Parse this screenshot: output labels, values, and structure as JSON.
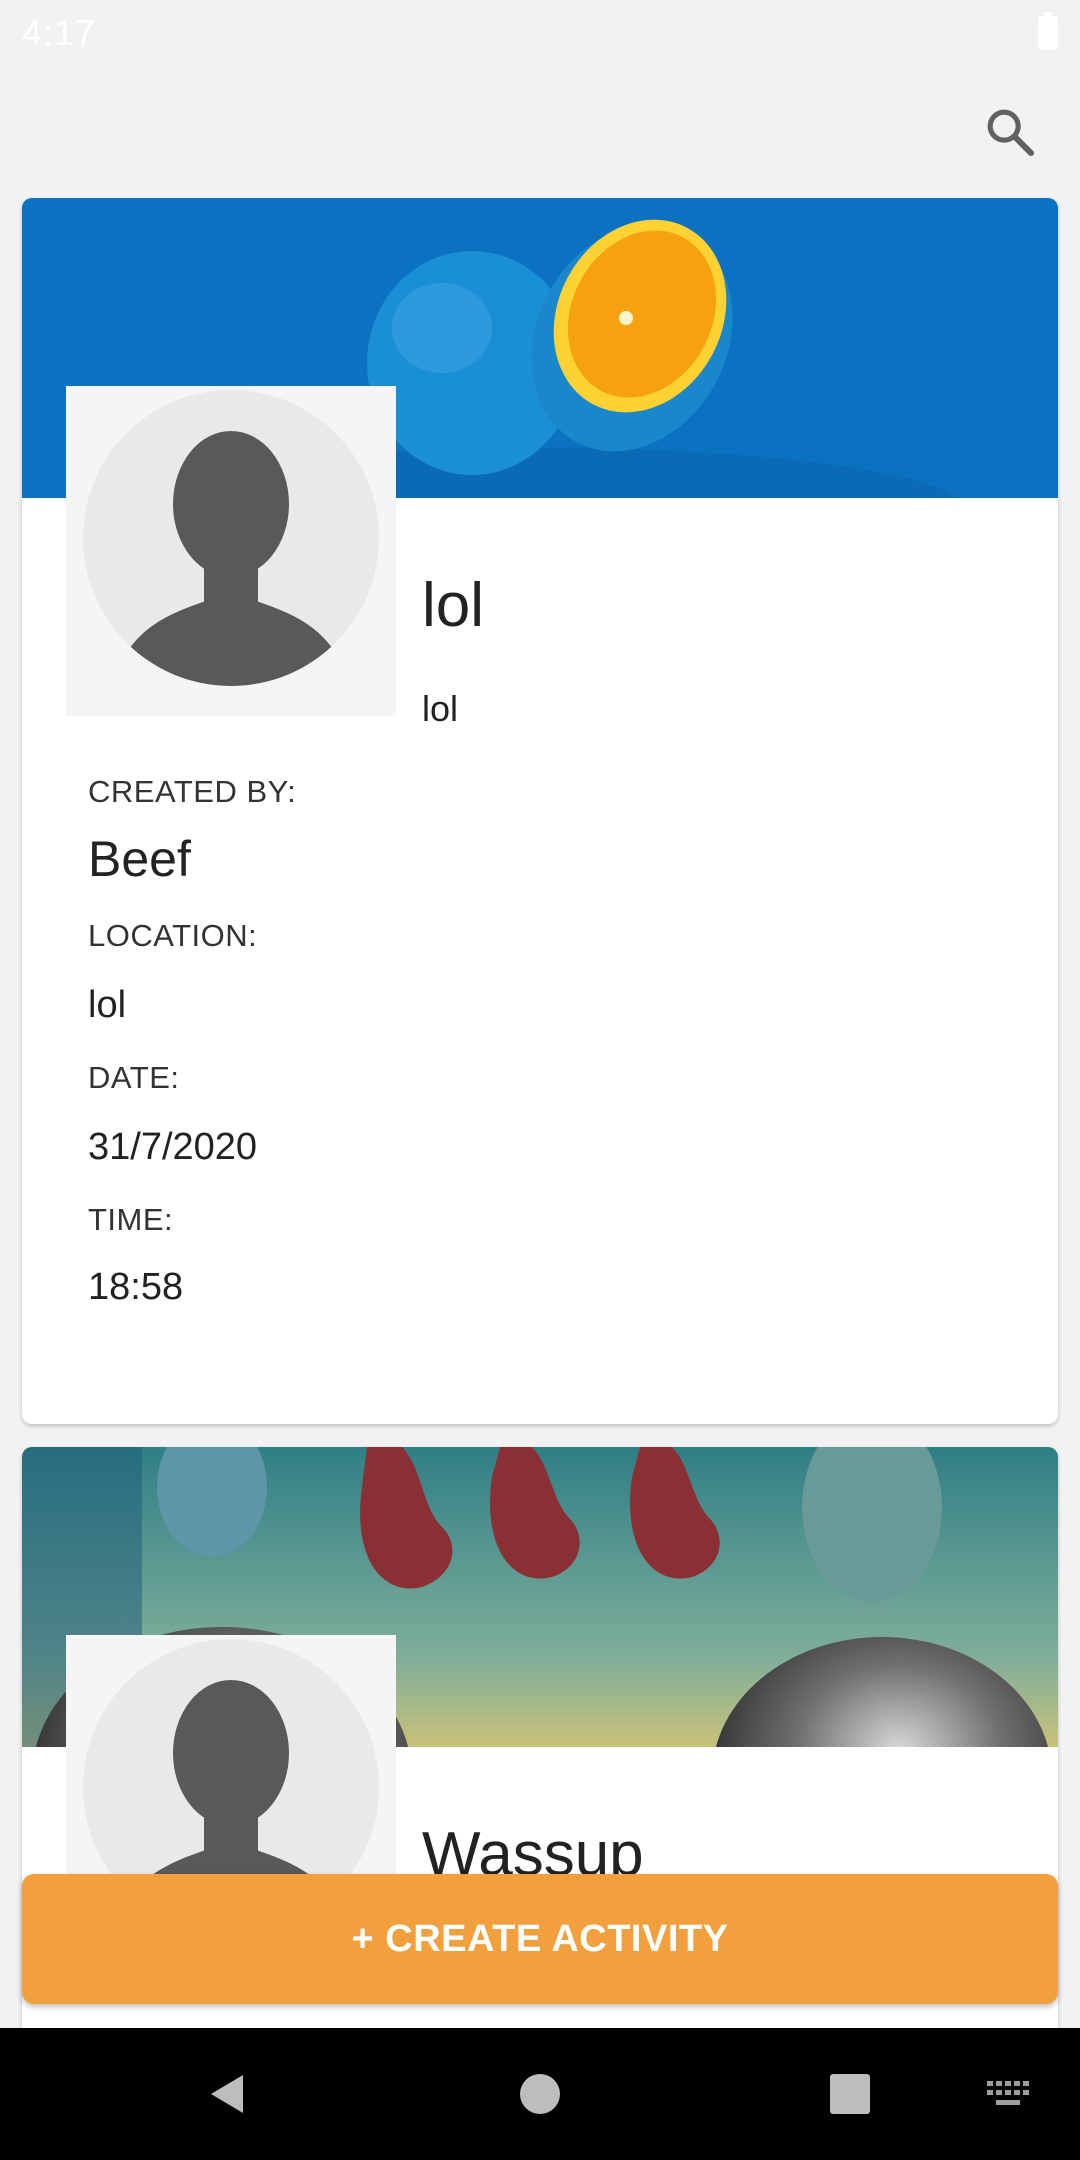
{
  "status_bar": {
    "time": "4:17"
  },
  "cards": [
    {
      "title": "lol",
      "description": "lol",
      "created_by_label": "CREATED BY:",
      "created_by": "Beef",
      "location_label": "LOCATION:",
      "location": "lol",
      "date_label": "DATE:",
      "date": "31/7/2020",
      "time_label": "TIME:",
      "time": "18:58"
    },
    {
      "title": "Wassup"
    }
  ],
  "fab": {
    "label": "+ CREATE ACTIVITY"
  },
  "icons": {
    "search": "search-icon",
    "back": "back-triangle-icon",
    "home": "home-circle-icon",
    "recents": "recents-square-icon",
    "keyboard": "keyboard-icon"
  },
  "colors": {
    "accent": "#f2a03d",
    "banner_blue": "#0a72c0",
    "nav_bar": "#000000"
  }
}
